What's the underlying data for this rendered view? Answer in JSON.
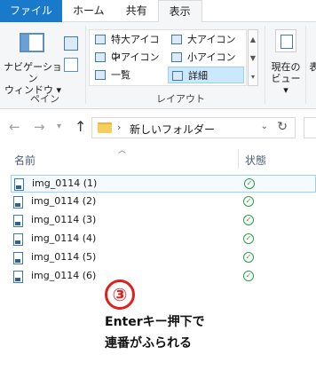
{
  "ribbon_tabs": [
    "ファイル",
    "ホーム",
    "共有",
    "表示"
  ],
  "pane_group": {
    "nav_pane_line1": "ナビゲーション",
    "nav_pane_line2": "ウィンドウ ▾",
    "label": "ペイン"
  },
  "layout_group": {
    "items": [
      "特大アイコン",
      "大アイコン",
      "中アイコン",
      "小アイコン",
      "一覧",
      "詳細"
    ],
    "selected": "詳細",
    "label": "レイアウト"
  },
  "view_group": {
    "current_view_line1": "現在の",
    "current_view_line2": "ビュー ▾",
    "partial": "表"
  },
  "address_bar": {
    "path": "新しいフォルダー"
  },
  "columns": {
    "name": "名前",
    "status": "状態"
  },
  "files": [
    {
      "name": "img_0114 (1)",
      "status": "synced"
    },
    {
      "name": "img_0114 (2)",
      "status": "synced"
    },
    {
      "name": "img_0114 (3)",
      "status": "synced"
    },
    {
      "name": "img_0114 (4)",
      "status": "synced"
    },
    {
      "name": "img_0114 (5)",
      "status": "synced"
    },
    {
      "name": "img_0114 (6)",
      "status": "synced"
    }
  ],
  "annotation": {
    "step": "③",
    "line1": "Enterキー押下で",
    "line2": "連番がふられる"
  },
  "colors": {
    "file_tab": "#1979ca",
    "selection": "#cce8ff",
    "status_ok": "#2f9e44",
    "annotation_red": "#e02020"
  }
}
